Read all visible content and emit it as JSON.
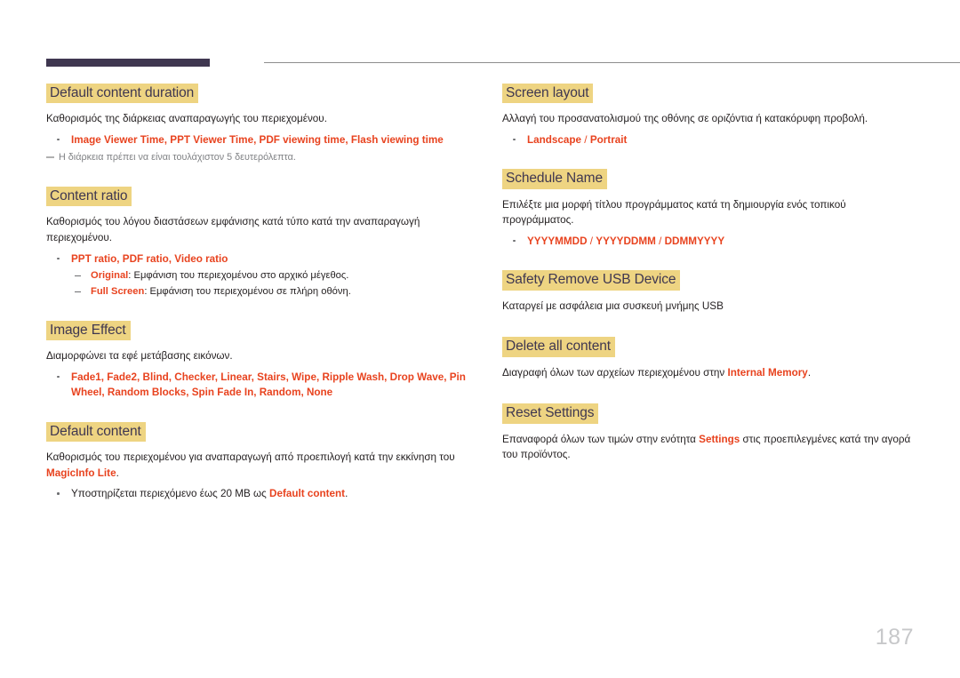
{
  "page": {
    "number": "187",
    "header_bar_color": "#3f3750",
    "highlight_color": "#eed482",
    "accent_color": "#e8431f"
  },
  "left_column": {
    "sections": [
      {
        "heading": "Default content duration",
        "body": "Καθορισμός της διάρκειας αναπαραγωγής του περιεχομένου.",
        "bullet": "Image Viewer Time, PPT Viewer Time, PDF viewing time, Flash viewing time",
        "note": "Η διάρκεια πρέπει να είναι τουλάχιστον 5 δευτερόλεπτα."
      },
      {
        "heading": "Content ratio",
        "body": "Καθορισμός του λόγου διαστάσεων εμφάνισης κατά τύπο κατά την αναπαραγωγή περιεχομένου.",
        "bullet": "PPT ratio, PDF ratio, Video ratio",
        "sub_items": [
          {
            "term": "Original",
            "desc": ": Εμφάνιση του περιεχομένου στο αρχικό μέγεθος."
          },
          {
            "term": "Full Screen",
            "desc": ": Εμφάνιση του περιεχομένου σε πλήρη οθόνη."
          }
        ]
      },
      {
        "heading": "Image Effect",
        "body": "Διαμορφώνει τα εφέ μετάβασης εικόνων.",
        "bullet": "Fade1, Fade2, Blind, Checker, Linear, Stairs, Wipe, Ripple Wash, Drop Wave, Pin Wheel, Random Blocks, Spin Fade In, Random, None"
      },
      {
        "heading": "Default content",
        "body_before": "Καθορισμός του περιεχομένου για αναπαραγωγή από προεπιλογή κατά την εκκίνηση του ",
        "body_accent": "MagicInfo Lite",
        "body_after": ".",
        "bullet_before": "Υποστηρίζεται περιεχόμενο έως 20 MB ως ",
        "bullet_accent": "Default content",
        "bullet_after": "."
      }
    ]
  },
  "right_column": {
    "sections": [
      {
        "heading": "Screen layout",
        "body": "Αλλαγή του προσανατολισμού της οθόνης σε οριζόντια ή κατακόρυφη προβολή.",
        "option_a": "Landscape",
        "separator": " / ",
        "option_b": "Portrait"
      },
      {
        "heading": "Schedule Name",
        "body": "Επιλέξτε μια μορφή τίτλου προγράμματος κατά τη δημιουργία ενός τοπικού προγράμματος.",
        "option_a": "YYYYMMDD",
        "separator_1": " / ",
        "option_b": "YYYYDDMM",
        "separator_2": " / ",
        "option_c": "DDMMYYYY"
      },
      {
        "heading": "Safety Remove USB Device",
        "body": "Καταργεί με ασφάλεια μια συσκευή μνήμης USB"
      },
      {
        "heading": "Delete all content",
        "body_before": "Διαγραφή όλων των αρχείων περιεχομένου στην ",
        "body_accent": "Internal Memory",
        "body_after": "."
      },
      {
        "heading": "Reset Settings",
        "body_before": "Επαναφορά όλων των τιμών στην ενότητα ",
        "body_accent": "Settings",
        "body_after": " στις προεπιλεγμένες κατά την αγορά του προϊόντος."
      }
    ]
  }
}
